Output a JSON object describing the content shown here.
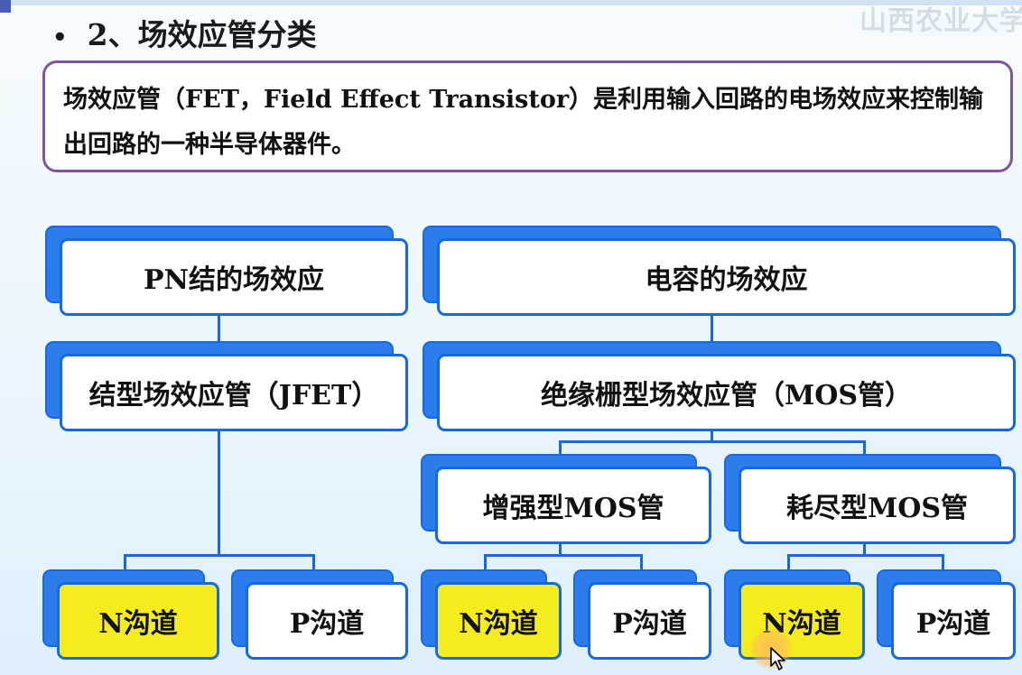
{
  "slide": {
    "bullet": "•",
    "title": "2、场效应管分类",
    "watermark": "山西农业大学",
    "definition": "场效应管（FET，Field Effect Transistor）是利用输入回路的电场效应来控制输出回路的一种半导体器件。"
  },
  "tree": {
    "pn_effect": "PN结的场效应",
    "cap_effect": "电容的场效应",
    "jfet": "结型场效应管（JFET）",
    "mos": "绝缘栅型场效应管（MOS管）",
    "enhance_mos": "增强型MOS管",
    "deplete_mos": "耗尽型MOS管",
    "jfet_n": "N沟道",
    "jfet_p": "P沟道",
    "enh_n": "N沟道",
    "enh_p": "P沟道",
    "dep_n": "N沟道",
    "dep_p": "P沟道"
  },
  "colors": {
    "box_border": "#1668e6",
    "highlight": "#f4ec1c",
    "definition_border": "#7d569f"
  }
}
